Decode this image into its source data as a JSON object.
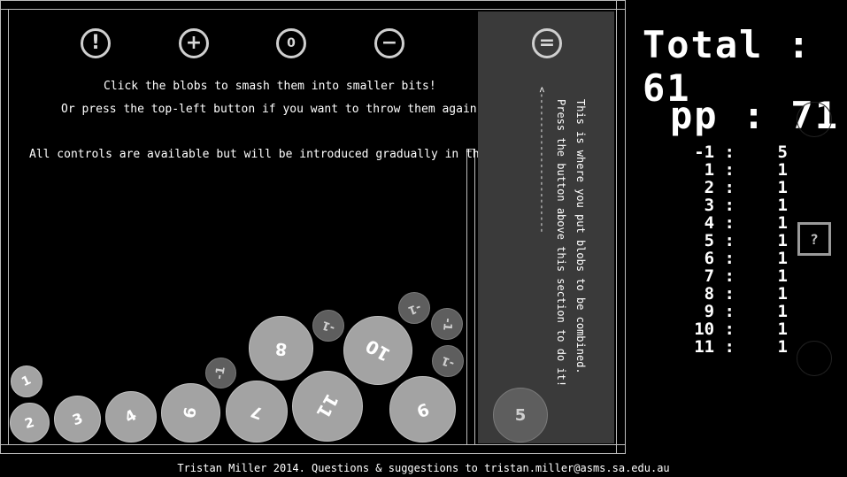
{
  "toolbar": {
    "throw_label": "!",
    "plus_label": "+",
    "zero_label": "0",
    "minus_label": "−",
    "combine_label": "="
  },
  "instructions": {
    "line1": "Click the blobs to smash them into smaller bits!",
    "line2": "Or press the top-left button if you want to throw them again!",
    "line3": "All controls are available but will be introduced gradually in the final rev."
  },
  "combine_panel": {
    "text1": "This is where you put blobs to be combined.",
    "text2": "Press the button above this section to do it!",
    "arrow": "<------------------------"
  },
  "blobs": [
    {
      "label": "1"
    },
    {
      "label": "2"
    },
    {
      "label": "3"
    },
    {
      "label": "4"
    },
    {
      "label": "6"
    },
    {
      "label": "7"
    },
    {
      "label": "-1"
    },
    {
      "label": "8"
    },
    {
      "label": "-1"
    },
    {
      "label": "11"
    },
    {
      "label": "10"
    },
    {
      "label": "-1"
    },
    {
      "label": "-1"
    },
    {
      "label": "-1"
    },
    {
      "label": "9"
    }
  ],
  "panel_blob": {
    "label": "5"
  },
  "scores": {
    "total_label": "Total : 61",
    "pp_label": "pp : 71"
  },
  "counts": [
    {
      "key": "-1 :",
      "value": "5"
    },
    {
      "key": "1 :",
      "value": "1"
    },
    {
      "key": "2 :",
      "value": "1"
    },
    {
      "key": "3 :",
      "value": "1"
    },
    {
      "key": "4 :",
      "value": "1"
    },
    {
      "key": "5 :",
      "value": "1"
    },
    {
      "key": "6 :",
      "value": "1"
    },
    {
      "key": "7 :",
      "value": "1"
    },
    {
      "key": "8 :",
      "value": "1"
    },
    {
      "key": "9 :",
      "value": "1"
    },
    {
      "key": "10 :",
      "value": "1"
    },
    {
      "key": "11 :",
      "value": "1"
    }
  ],
  "help_label": "?",
  "footer": "Tristan Miller 2014. Questions & suggestions to tristan.miller@asms.sa.edu.au"
}
